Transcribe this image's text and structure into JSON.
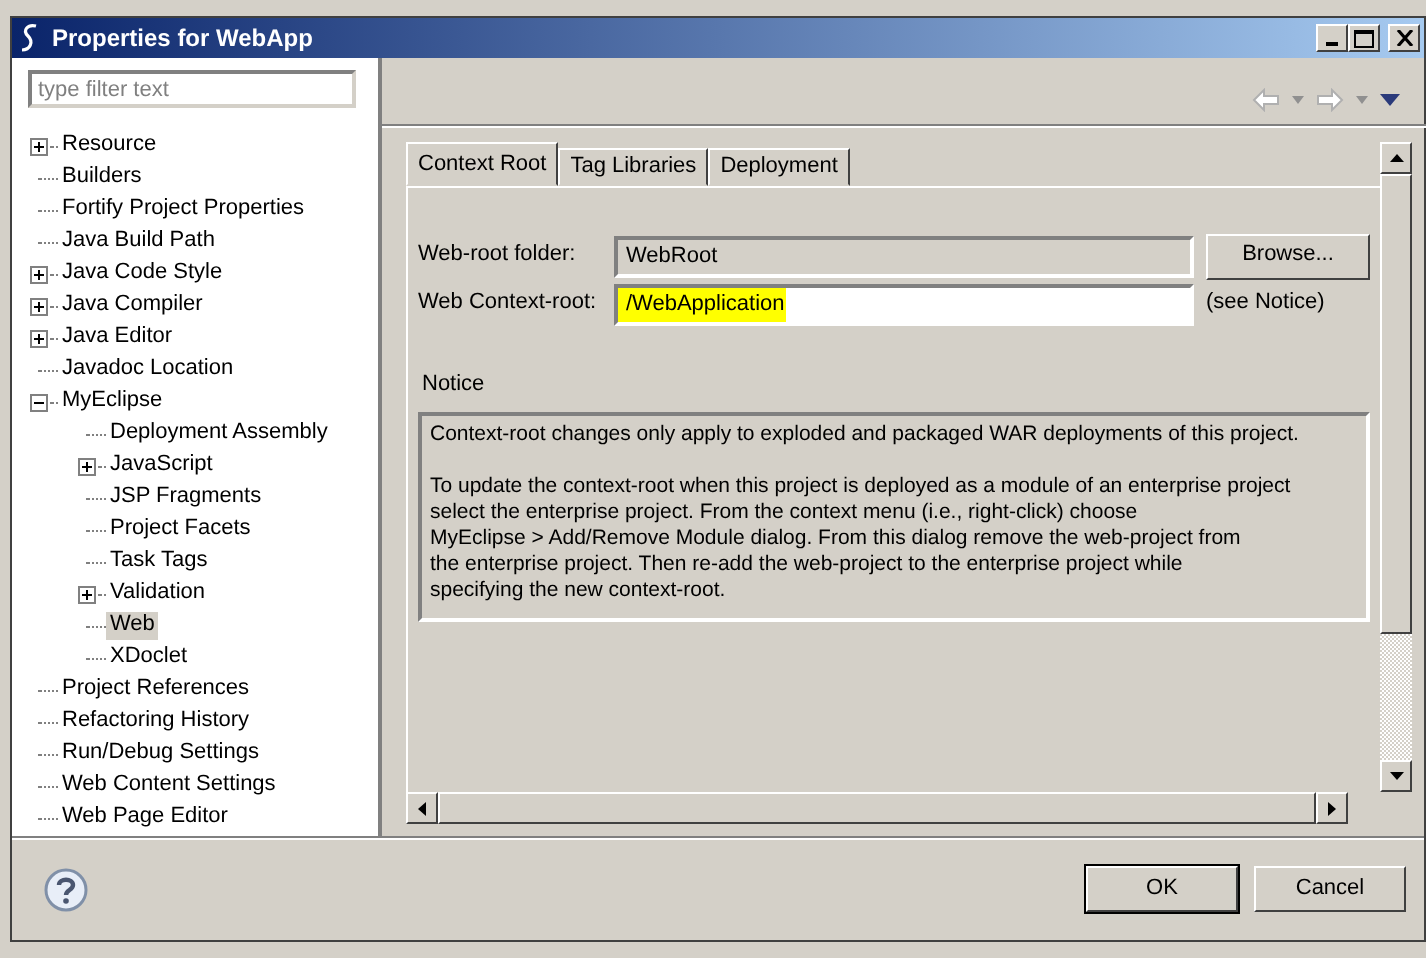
{
  "window": {
    "title": "Properties for WebApp"
  },
  "filter": {
    "placeholder": "type filter text"
  },
  "tree": [
    {
      "label": "Resource",
      "expanded": false,
      "selected": false
    },
    {
      "label": "Builders",
      "selected": false
    },
    {
      "label": "Fortify Project Properties",
      "selected": false
    },
    {
      "label": "Java Build Path",
      "selected": false
    },
    {
      "label": "Java Code Style",
      "expanded": false,
      "selected": false
    },
    {
      "label": "Java Compiler",
      "expanded": false,
      "selected": false
    },
    {
      "label": "Java Editor",
      "expanded": false,
      "selected": false
    },
    {
      "label": "Javadoc Location",
      "selected": false
    },
    {
      "label": "MyEclipse",
      "expanded": true,
      "selected": false,
      "children": [
        {
          "label": "Deployment Assembly",
          "selected": false
        },
        {
          "label": "JavaScript",
          "expanded": false,
          "selected": false
        },
        {
          "label": "JSP Fragments",
          "selected": false
        },
        {
          "label": "Project Facets",
          "selected": false
        },
        {
          "label": "Task Tags",
          "selected": false
        },
        {
          "label": "Validation",
          "expanded": false,
          "selected": false
        },
        {
          "label": "Web",
          "selected": true
        },
        {
          "label": "XDoclet",
          "selected": false
        }
      ]
    },
    {
      "label": "Project References",
      "selected": false
    },
    {
      "label": "Refactoring History",
      "selected": false
    },
    {
      "label": "Run/Debug Settings",
      "selected": false
    },
    {
      "label": "Web Content Settings",
      "selected": false
    },
    {
      "label": "Web Page Editor",
      "selected": false
    }
  ],
  "tabs": [
    {
      "label": "Context Root",
      "selected": true
    },
    {
      "label": "Tag Libraries",
      "selected": false
    },
    {
      "label": "Deployment",
      "selected": false
    }
  ],
  "fields": [
    {
      "label": "Web-root folder:",
      "value": "WebRoot",
      "disabled": true,
      "button": "Browse..."
    },
    {
      "label": "Web Context-root:",
      "value": "/WebApplication",
      "disabled": false,
      "highlighted": true,
      "note": "(see Notice)"
    }
  ],
  "notice": {
    "title": "Notice",
    "text": "Context-root changes only apply to exploded and packaged WAR deployments of this project.\n\nTo update the context-root when this project is deployed as a module of an enterprise project\nselect the enterprise project. From the context menu (i.e., right-click) choose\nMyEclipse > Add/Remove Module dialog. From this dialog remove the web-project from\nthe enterprise project. Then re-add the web-project to the enterprise project while\nspecifying the new context-root."
  },
  "buttons": [
    "OK",
    "Cancel"
  ]
}
